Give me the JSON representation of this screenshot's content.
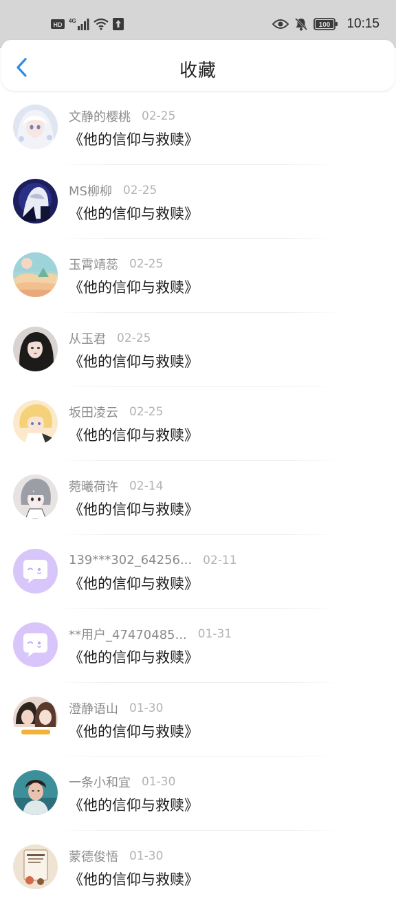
{
  "status_bar": {
    "time": "10:15",
    "hd": "HD",
    "network": "4G",
    "battery": "100"
  },
  "header": {
    "title": "收藏",
    "back_icon": "chevron-left-icon",
    "accent": "#2a8cf2"
  },
  "items": [
    {
      "name": "文静的樱桃",
      "date": "02-25",
      "title": "《他的信仰与救赎》",
      "avatar": "anime-white-hair"
    },
    {
      "name": "MS柳柳",
      "date": "02-25",
      "title": "《他的信仰与救赎》",
      "avatar": "anime-dark-blue"
    },
    {
      "name": "玉霄靖蕊",
      "date": "02-25",
      "title": "《他的信仰与救赎》",
      "avatar": "pastel-landscape"
    },
    {
      "name": "从玉君",
      "date": "02-25",
      "title": "《他的信仰与救赎》",
      "avatar": "girl-dark-hair"
    },
    {
      "name": "坂田凌云",
      "date": "02-25",
      "title": "《他的信仰与救赎》",
      "avatar": "anime-blonde"
    },
    {
      "name": "菀曦荷许",
      "date": "02-14",
      "title": "《他的信仰与救赎》",
      "avatar": "anime-gray-hair"
    },
    {
      "name": "139***302_64256...",
      "date": "02-11",
      "title": "《他的信仰与救赎》",
      "avatar": "default-purple"
    },
    {
      "name": "**用户_47470485...",
      "date": "01-31",
      "title": "《他的信仰与救赎》",
      "avatar": "default-purple"
    },
    {
      "name": "澄静语山",
      "date": "01-30",
      "title": "《他的信仰与救赎》",
      "avatar": "couple-photo"
    },
    {
      "name": "一条小和宜",
      "date": "01-30",
      "title": "《他的信仰与救赎》",
      "avatar": "boy-teal"
    },
    {
      "name": "蒙德俊悟",
      "date": "01-30",
      "title": "《他的信仰与救赎》",
      "avatar": "illustration-cup"
    }
  ]
}
